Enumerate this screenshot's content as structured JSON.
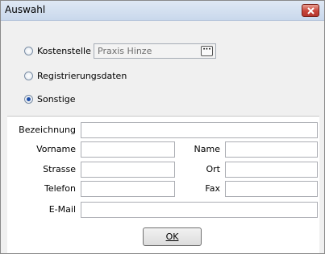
{
  "window": {
    "title": "Auswahl"
  },
  "options": [
    {
      "label": "Kostenstelle",
      "checked": false
    },
    {
      "label": "Registrierungsdaten",
      "checked": false
    },
    {
      "label": "Sonstige",
      "checked": true
    }
  ],
  "kostenstelle": {
    "value": "Praxis Hinze",
    "button_glyph": "···"
  },
  "fields": {
    "bezeichnung": {
      "label": "Bezeichnung",
      "value": ""
    },
    "vorname": {
      "label": "Vorname",
      "value": ""
    },
    "name": {
      "label": "Name",
      "value": ""
    },
    "strasse": {
      "label": "Strasse",
      "value": ""
    },
    "ort": {
      "label": "Ort",
      "value": ""
    },
    "telefon": {
      "label": "Telefon",
      "value": ""
    },
    "fax": {
      "label": "Fax",
      "value": ""
    },
    "email": {
      "label": "E-Mail",
      "value": ""
    }
  },
  "actions": {
    "ok_label": "OK"
  },
  "icons": {
    "close": "close-icon"
  },
  "colors": {
    "close_button": "#c7443a",
    "titlebar": "#c9d8ec"
  }
}
